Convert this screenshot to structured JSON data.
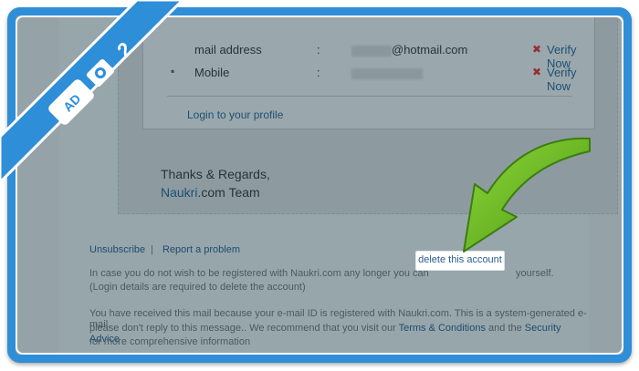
{
  "email": {
    "rows": [
      {
        "label": "mail address",
        "value_suffix": "@hotmail.com",
        "verify": "Verify Now"
      },
      {
        "label": "Mobile",
        "value_suffix": "",
        "verify": "Verify Now"
      }
    ],
    "login_link": "Login to your profile",
    "regards": "Thanks & Regards,",
    "brand": "Naukri",
    "brand_suffix": ".com",
    "team": "Team",
    "colon": ":"
  },
  "footer": {
    "unsubscribe": "Unsubscribe",
    "separator": "|",
    "report": "Report a problem",
    "delete_prefix": "In case you do not wish to be registered with Naukri.com any longer you can",
    "delete_link": "delete this account",
    "delete_suffix": "yourself.",
    "login_note": "(Login details are required to delete the account)",
    "notice_1": "You have received this mail because your e-mail ID is registered with Naukri.com. This is a system-generated e-mail,",
    "notice_2_prefix": "please don't reply to this message.. We recommend that you visit our",
    "terms": "Terms & Conditions",
    "and": "and the",
    "security": "Security Advice",
    "notice_3": "for more comprehensive information"
  },
  "badge": {
    "step": "2",
    "ad_text": "AD",
    "colors": {
      "ribbon": "#2f8ed8",
      "text": "#ffffff"
    }
  },
  "colors": {
    "frame": "#2f8ed8",
    "arrow": "#6fbf1f",
    "link": "#1e4f73"
  }
}
